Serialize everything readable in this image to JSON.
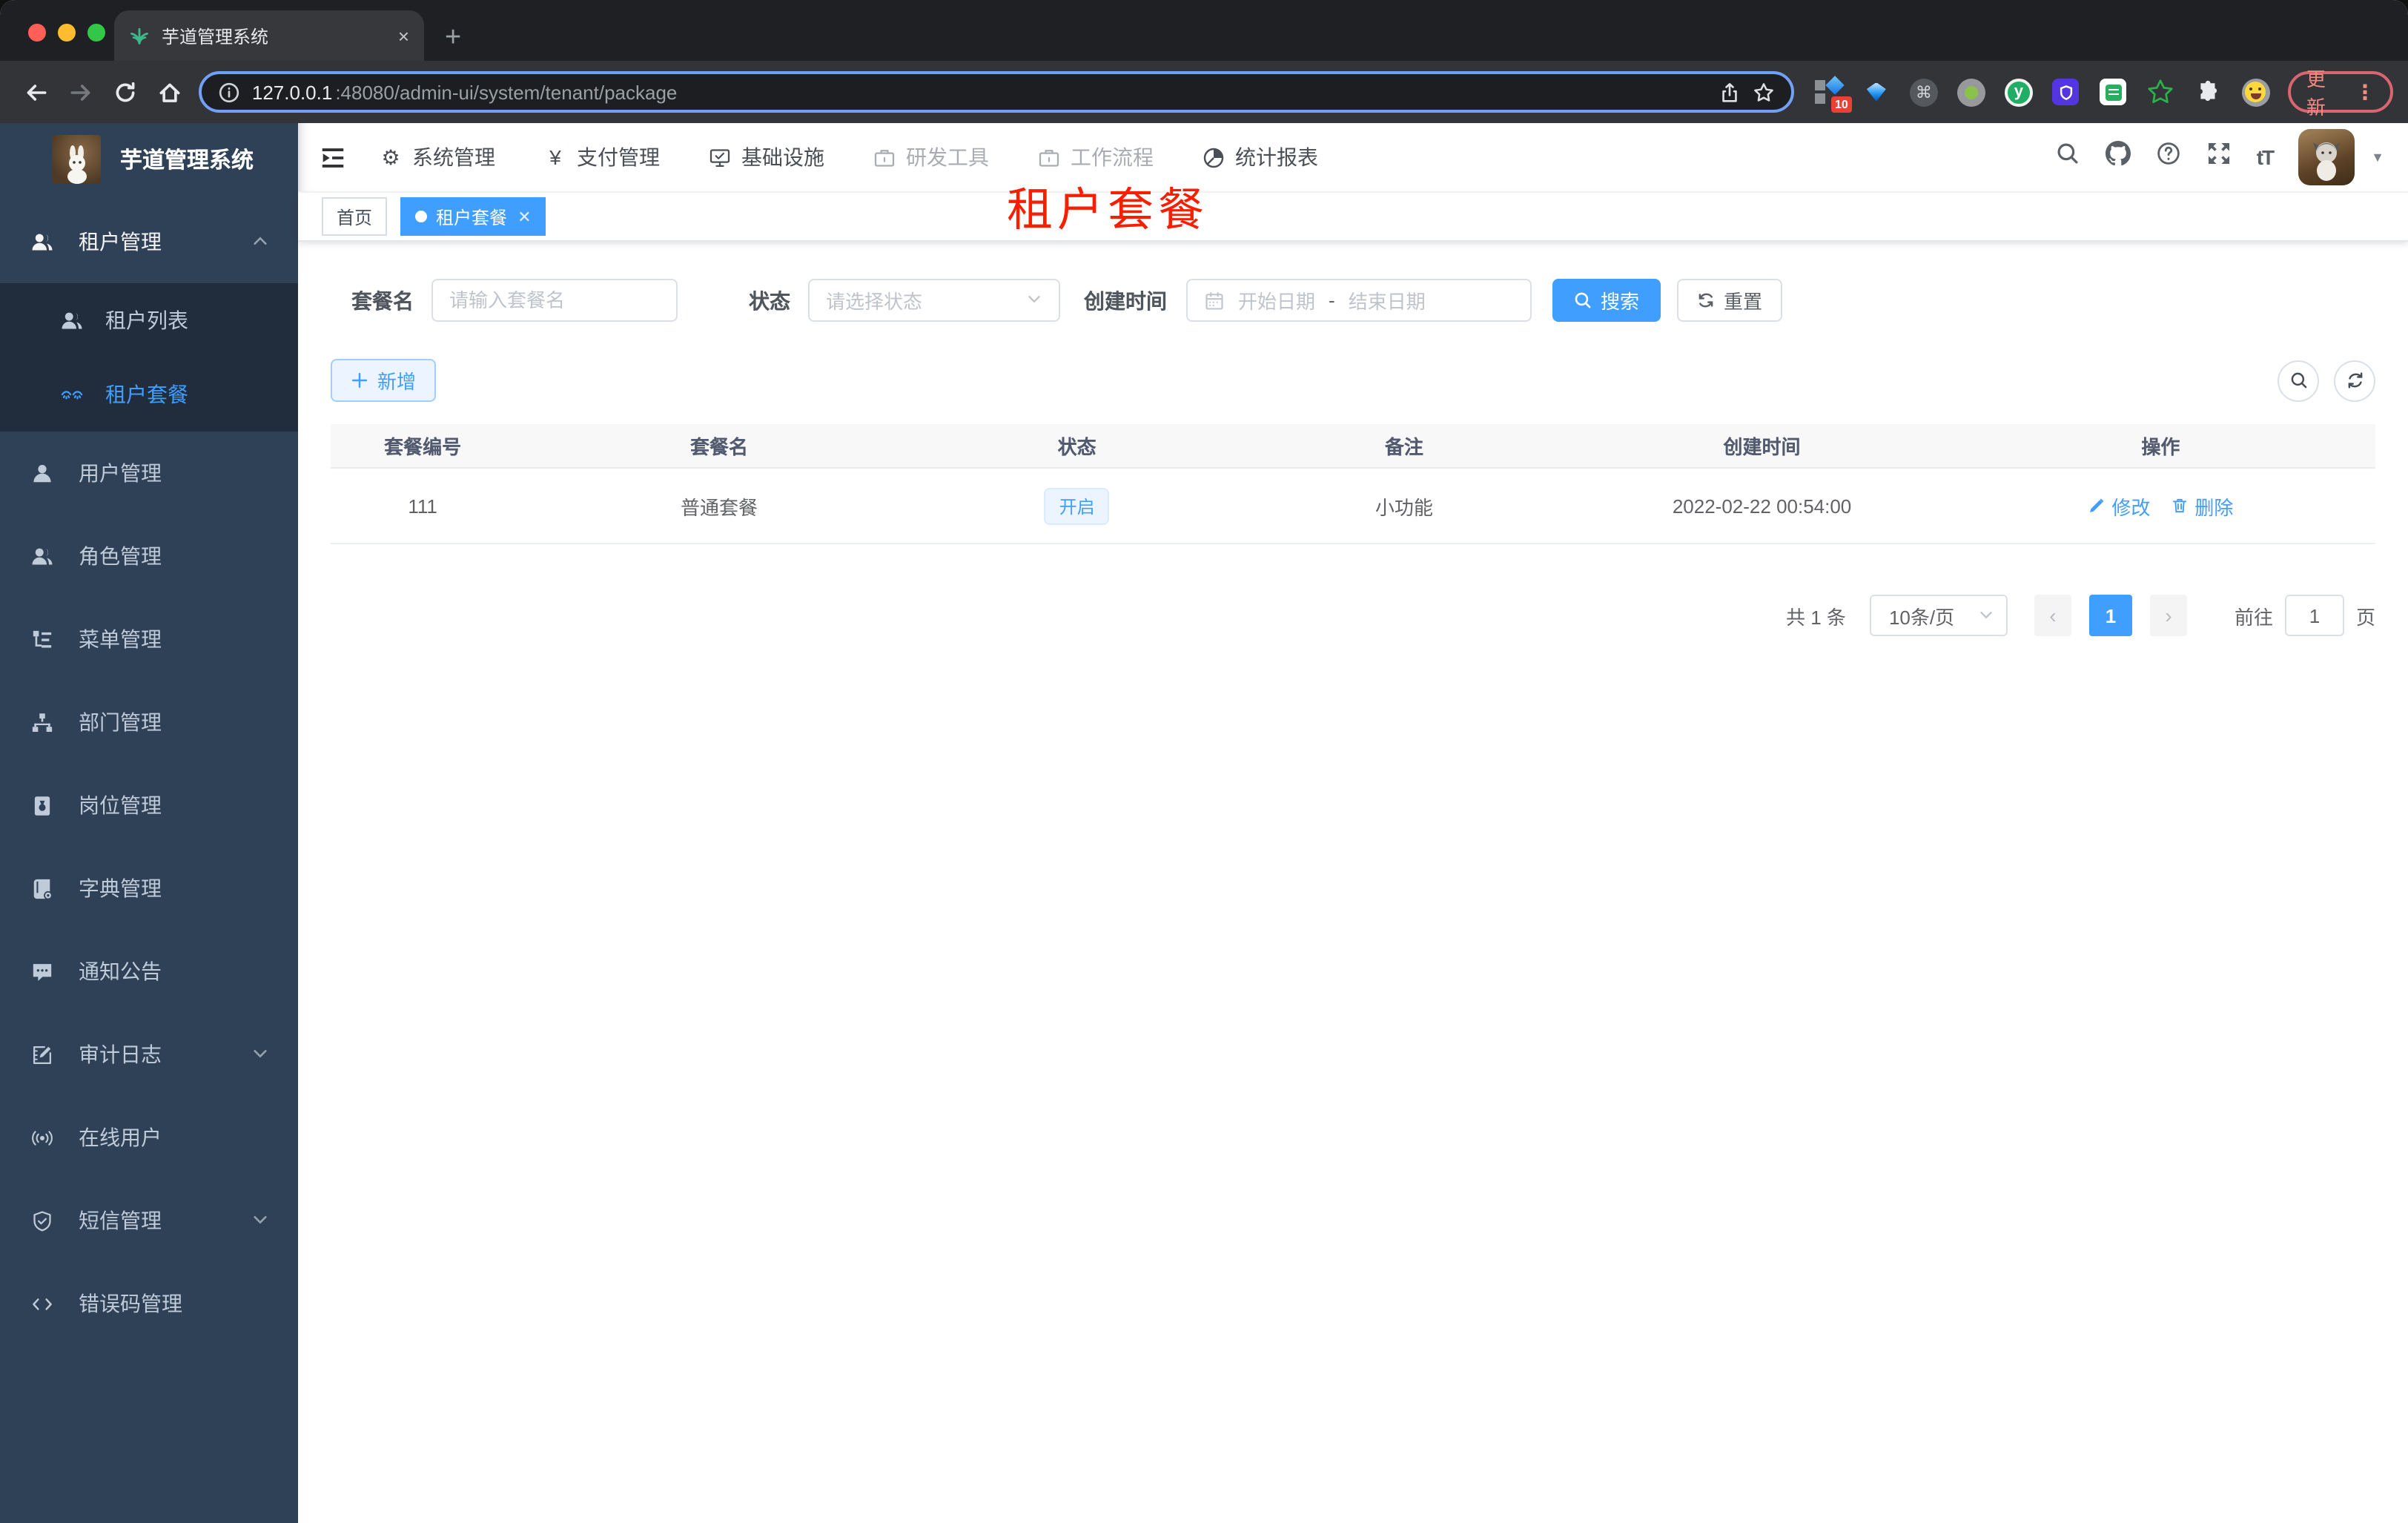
{
  "colors": {
    "accent": "#409eff",
    "overlay_red": "#f81f00",
    "sidebar_bg": "#2f4156",
    "submenu_bg": "#212d3d"
  },
  "browser": {
    "tab_title": "芋道管理系统",
    "new_tab": "+",
    "close_tab": "×",
    "url_host": "127.0.0.1",
    "url_path": ":48080/admin-ui/system/tenant/package",
    "ext_badge": "10",
    "update_label": "更新",
    "menu_dots": "⋮"
  },
  "header": {
    "logo_title": "芋道管理系统",
    "yen": "¥",
    "font_size_icon": "tT",
    "nav": [
      {
        "label": "系统管理"
      },
      {
        "label": "支付管理"
      },
      {
        "label": "基础设施"
      },
      {
        "label": "研发工具"
      },
      {
        "label": "工作流程"
      },
      {
        "label": "统计报表"
      }
    ]
  },
  "sidebar": {
    "items": [
      {
        "label": "租户管理"
      },
      {
        "label": "租户列表"
      },
      {
        "label": "租户套餐"
      },
      {
        "label": "用户管理"
      },
      {
        "label": "角色管理"
      },
      {
        "label": "菜单管理"
      },
      {
        "label": "部门管理"
      },
      {
        "label": "岗位管理"
      },
      {
        "label": "字典管理"
      },
      {
        "label": "通知公告"
      },
      {
        "label": "审计日志"
      },
      {
        "label": "在线用户"
      },
      {
        "label": "短信管理"
      },
      {
        "label": "错误码管理"
      }
    ]
  },
  "tags": {
    "home": "首页",
    "active": "租户套餐",
    "close": "✕"
  },
  "overlay_title": "租户套餐",
  "filters": {
    "name_label": "套餐名",
    "name_placeholder": "请输入套餐名",
    "status_label": "状态",
    "status_placeholder": "请选择状态",
    "date_label": "创建时间",
    "date_start": "开始日期",
    "date_sep": "-",
    "date_end": "结束日期",
    "search": "搜索",
    "reset": "重置"
  },
  "toolbar": {
    "add": "新增"
  },
  "table": {
    "columns": [
      "套餐编号",
      "套餐名",
      "状态",
      "备注",
      "创建时间",
      "操作"
    ],
    "rows": [
      {
        "id": "111",
        "name": "普通套餐",
        "status": "开启",
        "remark": "小功能",
        "created": "2022-02-22 00:54:00",
        "edit": "修改",
        "delete": "删除"
      }
    ]
  },
  "pagination": {
    "total": "共 1 条",
    "per_page": "10条/页",
    "prev": "‹",
    "page": "1",
    "next": "›",
    "goto_prefix": "前往",
    "goto_value": "1",
    "goto_suffix": "页"
  }
}
